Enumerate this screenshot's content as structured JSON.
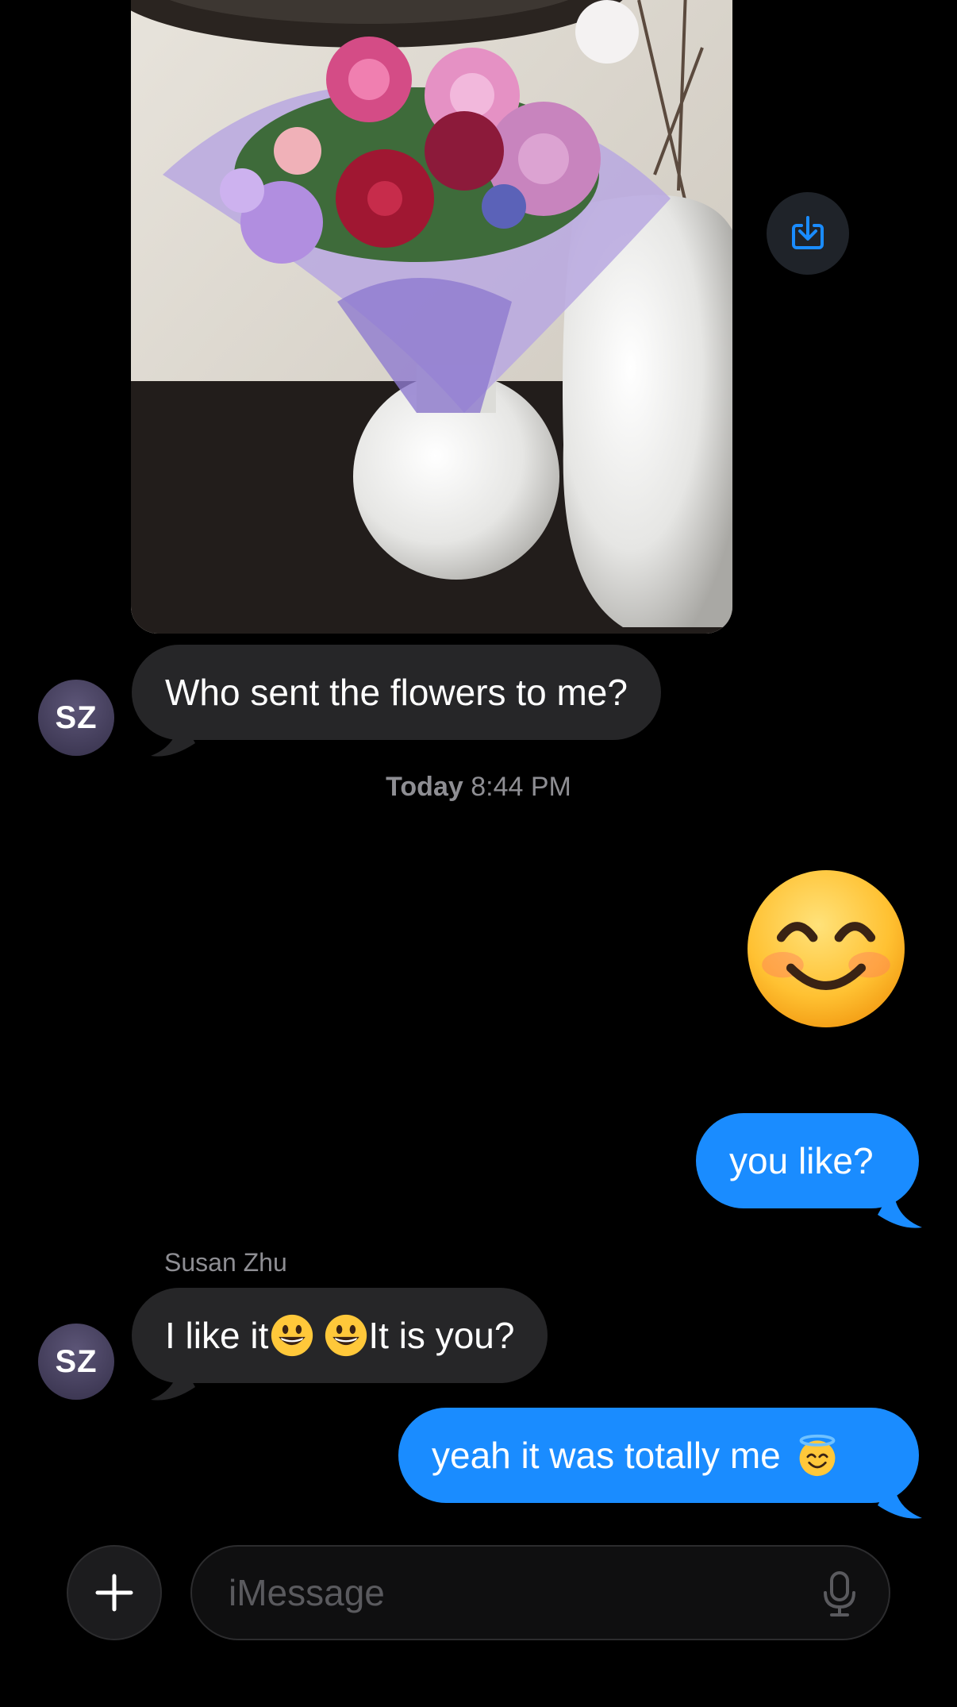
{
  "conversation": {
    "incoming_1": "Who sent the flowers to me?",
    "avatar_initials": "SZ",
    "timestamp_day": "Today",
    "timestamp_time": "8:44 PM",
    "big_emoji": "smiling-face-with-smiling-eyes",
    "outgoing_1": "you like?",
    "sender_name": "Susan Zhu",
    "incoming_2_part1": "I like it",
    "incoming_2_part2": "It is you?",
    "outgoing_2": "yeah it was totally me",
    "outgoing_2_emoji": "smiling-face-with-halo"
  },
  "composer": {
    "placeholder": "iMessage"
  },
  "colors": {
    "outgoing_bubble": "#1a8cff",
    "incoming_bubble": "#262628",
    "background": "#000000",
    "accent_icon": "#1a8cff"
  }
}
